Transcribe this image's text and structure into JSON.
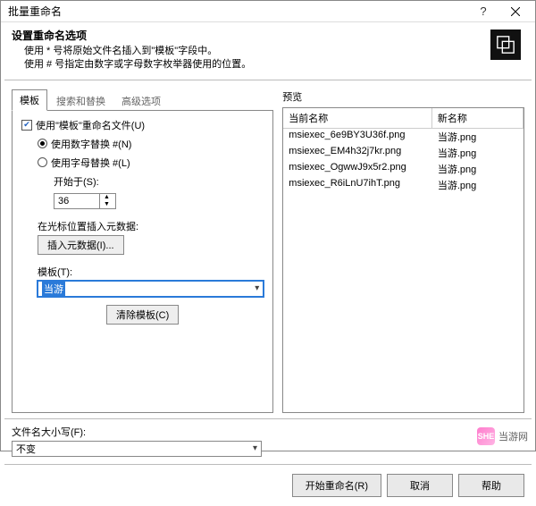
{
  "window": {
    "title": "批量重命名",
    "help_symbol": "?",
    "close_label": "close"
  },
  "header": {
    "title": "设置重命名选项",
    "line1": "使用 * 号将原始文件名插入到\"模板\"字段中。",
    "line2": "使用 # 号指定由数字或字母数字枚举器使用的位置。"
  },
  "tabs": [
    {
      "label": "模板",
      "active": true
    },
    {
      "label": "搜索和替换",
      "active": false
    },
    {
      "label": "高级选项",
      "active": false
    }
  ],
  "template_panel": {
    "use_template_label": "使用\"模板\"重命名文件(U)",
    "use_template_checked": true,
    "opt_numeric_label": "使用数字替换 #(N)",
    "opt_numeric_checked": true,
    "opt_alpha_label": "使用字母替换 #(L)",
    "opt_alpha_checked": false,
    "start_at_label": "开始于(S):",
    "start_at_value": "36",
    "insert_meta_label": "在光标位置插入元数据:",
    "insert_meta_btn": "插入元数据(I)...",
    "template_field_label": "模板(T):",
    "template_value": "当游",
    "clear_template_btn": "清除模板(C)"
  },
  "preview": {
    "section_label": "预览",
    "col_current": "当前名称",
    "col_new": "新名称",
    "rows": [
      {
        "current": "msiexec_6e9BY3U36f.png",
        "new_": "当游.png"
      },
      {
        "current": "msiexec_EM4h32j7kr.png",
        "new_": "当游.png"
      },
      {
        "current": "msiexec_OgwwJ9x5r2.png",
        "new_": "当游.png"
      },
      {
        "current": "msiexec_R6iLnU7ihT.png",
        "new_": "当游.png"
      }
    ]
  },
  "filecase": {
    "label": "文件名大小写(F):",
    "value": "不变"
  },
  "buttons": {
    "start": "开始重命名(R)",
    "cancel": "取消",
    "help": "帮助"
  },
  "watermark": {
    "logo_text": "SHE",
    "site": "当游网"
  }
}
